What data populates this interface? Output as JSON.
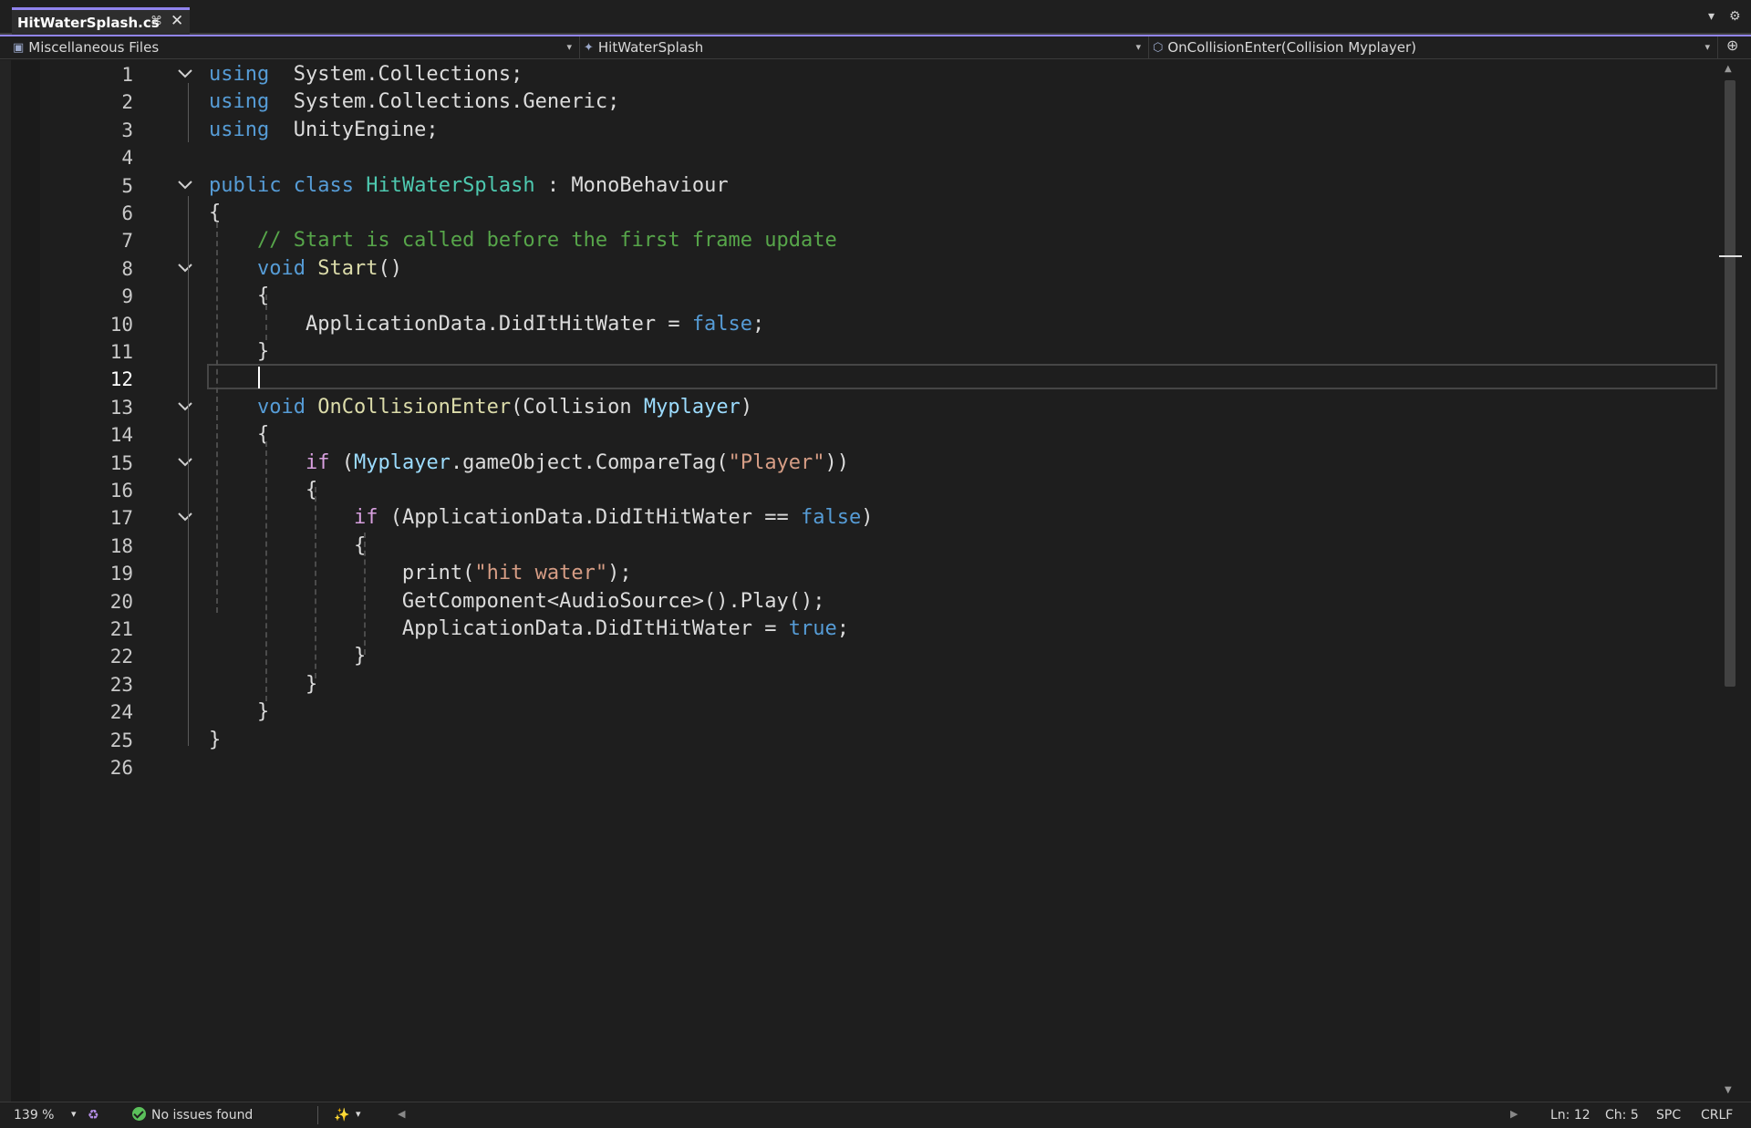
{
  "tab": {
    "filename": "HitWaterSplash.cs",
    "pin_icon": "pin-icon",
    "close_icon": "close-icon"
  },
  "navbar": {
    "project": "Miscellaneous Files",
    "class": "HitWaterSplash",
    "member": "OnCollisionEnter(Collision Myplayer)"
  },
  "editor": {
    "current_line": 12,
    "lines": [
      {
        "n": "1",
        "tokens": [
          [
            "kw",
            "using"
          ],
          [
            "",
            "  System.Collections;"
          ]
        ]
      },
      {
        "n": "2",
        "tokens": [
          [
            "kw",
            "using"
          ],
          [
            "",
            "  System.Collections.Generic;"
          ]
        ]
      },
      {
        "n": "3",
        "tokens": [
          [
            "kw",
            "using"
          ],
          [
            "",
            "  UnityEngine;"
          ]
        ]
      },
      {
        "n": "4",
        "tokens": []
      },
      {
        "n": "5",
        "tokens": [
          [
            "kw",
            "public"
          ],
          [
            "",
            " "
          ],
          [
            "kw",
            "class"
          ],
          [
            "",
            " "
          ],
          [
            "typ",
            "HitWaterSplash"
          ],
          [
            "",
            " : MonoBehaviour"
          ]
        ]
      },
      {
        "n": "6",
        "tokens": [
          [
            "",
            "{"
          ]
        ]
      },
      {
        "n": "7",
        "tokens": [
          [
            "",
            "    "
          ],
          [
            "cmt",
            "// Start is called before the first frame update"
          ]
        ]
      },
      {
        "n": "8",
        "tokens": [
          [
            "",
            "    "
          ],
          [
            "kw",
            "void"
          ],
          [
            "",
            " "
          ],
          [
            "fn",
            "Start"
          ],
          [
            "",
            "()"
          ]
        ]
      },
      {
        "n": "9",
        "tokens": [
          [
            "",
            "    {"
          ]
        ]
      },
      {
        "n": "10",
        "tokens": [
          [
            "",
            "        ApplicationData.DidItHitWater = "
          ],
          [
            "kw",
            "false"
          ],
          [
            "",
            ";"
          ]
        ]
      },
      {
        "n": "11",
        "tokens": [
          [
            "",
            "    }"
          ]
        ]
      },
      {
        "n": "12",
        "tokens": []
      },
      {
        "n": "13",
        "tokens": [
          [
            "",
            "    "
          ],
          [
            "kw",
            "void"
          ],
          [
            "",
            " "
          ],
          [
            "fn",
            "OnCollisionEnter"
          ],
          [
            "",
            "(Collision "
          ],
          [
            "par",
            "Myplayer"
          ],
          [
            "",
            ")"
          ]
        ]
      },
      {
        "n": "14",
        "tokens": [
          [
            "",
            "    {"
          ]
        ]
      },
      {
        "n": "15",
        "tokens": [
          [
            "",
            "        "
          ],
          [
            "ctl",
            "if"
          ],
          [
            "",
            " ("
          ],
          [
            "par",
            "Myplayer"
          ],
          [
            "",
            ".gameObject.CompareTag("
          ],
          [
            "str",
            "\"Player\""
          ],
          [
            "",
            "))"
          ]
        ]
      },
      {
        "n": "16",
        "tokens": [
          [
            "",
            "        {"
          ]
        ]
      },
      {
        "n": "17",
        "tokens": [
          [
            "",
            "            "
          ],
          [
            "ctl",
            "if"
          ],
          [
            "",
            " (ApplicationData.DidItHitWater == "
          ],
          [
            "kw",
            "false"
          ],
          [
            "",
            ")"
          ]
        ]
      },
      {
        "n": "18",
        "tokens": [
          [
            "",
            "            {"
          ]
        ]
      },
      {
        "n": "19",
        "tokens": [
          [
            "",
            "                print("
          ],
          [
            "str",
            "\"hit water\""
          ],
          [
            "",
            ");"
          ]
        ]
      },
      {
        "n": "20",
        "tokens": [
          [
            "",
            "                GetComponent<AudioSource>().Play();"
          ]
        ]
      },
      {
        "n": "21",
        "tokens": [
          [
            "",
            "                ApplicationData.DidItHitWater = "
          ],
          [
            "kw",
            "true"
          ],
          [
            "",
            ";"
          ]
        ]
      },
      {
        "n": "22",
        "tokens": [
          [
            "",
            "            }"
          ]
        ]
      },
      {
        "n": "23",
        "tokens": [
          [
            "",
            "        }"
          ]
        ]
      },
      {
        "n": "24",
        "tokens": [
          [
            "",
            "    }"
          ]
        ]
      },
      {
        "n": "25",
        "tokens": [
          [
            "",
            "}"
          ]
        ]
      },
      {
        "n": "26",
        "tokens": []
      }
    ],
    "fold_lines": [
      "1",
      "5",
      "8",
      "13",
      "15",
      "17"
    ]
  },
  "status": {
    "zoom": "139 %",
    "issues": "No issues found",
    "position_line": "Ln: 12",
    "position_char": "Ch: 5",
    "indent": "SPC",
    "line_ending": "CRLF"
  }
}
